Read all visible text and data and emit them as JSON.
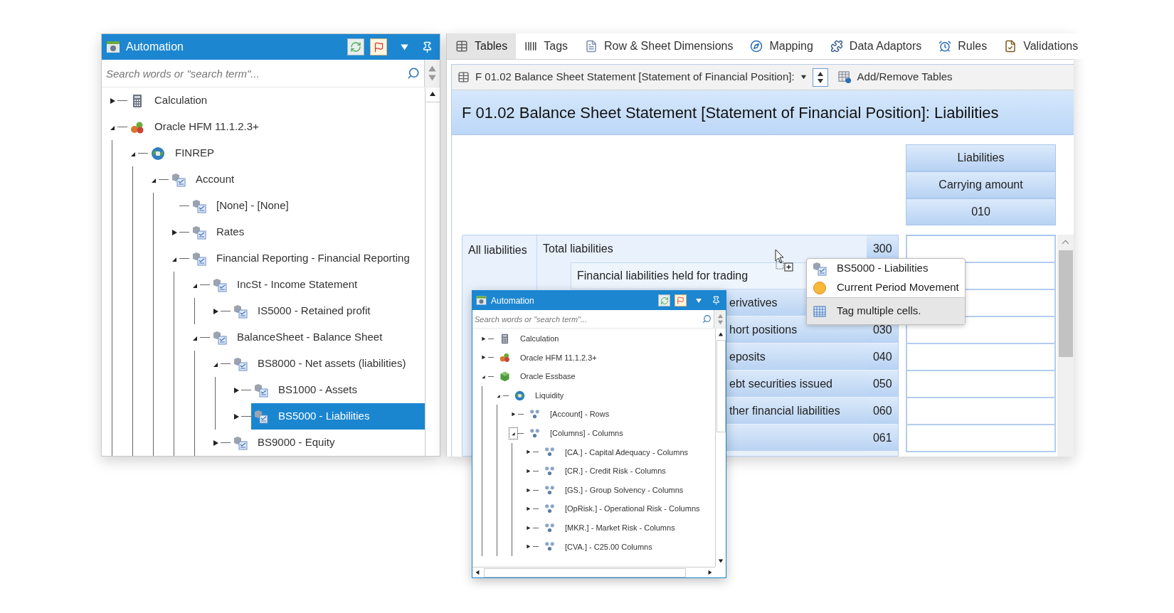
{
  "automation_panel": {
    "title": "Automation",
    "search": {
      "placeholder": "Search words or \"search term\"..."
    },
    "tree": [
      {
        "label": "Calculation",
        "kind": "calculator",
        "expanded": false,
        "selected": false
      },
      {
        "label": "Oracle HFM 11.1.2.3+",
        "kind": "cubes",
        "expanded": true,
        "selected": false,
        "children": [
          {
            "label": "FINREP",
            "kind": "globe",
            "expanded": true,
            "selected": false,
            "children": [
              {
                "label": "Account",
                "kind": "dimension",
                "expanded": true,
                "selected": false,
                "children": [
                  {
                    "label": "[None] - [None]",
                    "kind": "dimension",
                    "selected": false
                  },
                  {
                    "label": "Rates",
                    "kind": "dimension",
                    "expanded": false,
                    "selected": false
                  },
                  {
                    "label": "Financial Reporting - Financial Reporting",
                    "kind": "dimension",
                    "expanded": true,
                    "selected": false,
                    "children": [
                      {
                        "label": "IncSt - Income Statement",
                        "kind": "dimension",
                        "expanded": true,
                        "selected": false,
                        "children": [
                          {
                            "label": "IS5000 - Retained profit",
                            "kind": "dimension",
                            "expanded": false,
                            "selected": false
                          }
                        ]
                      },
                      {
                        "label": "BalanceSheet - Balance Sheet",
                        "kind": "dimension",
                        "expanded": true,
                        "selected": false,
                        "children": [
                          {
                            "label": "BS8000 - Net assets (liabilities)",
                            "kind": "dimension",
                            "expanded": true,
                            "selected": false,
                            "children": [
                              {
                                "label": "BS1000 - Assets",
                                "kind": "dimension",
                                "expanded": false,
                                "selected": false
                              },
                              {
                                "label": "BS5000 - Liabilities",
                                "kind": "dimension",
                                "expanded": false,
                                "selected": true
                              }
                            ]
                          },
                          {
                            "label": "BS9000 - Equity",
                            "kind": "dimension",
                            "expanded": false,
                            "selected": false
                          }
                        ]
                      }
                    ]
                  }
                ]
              }
            ]
          }
        ]
      }
    ]
  },
  "editor": {
    "tabs": [
      {
        "label": "Tables",
        "kind": "tables",
        "selected": true
      },
      {
        "label": "Tags",
        "kind": "tags",
        "selected": false
      },
      {
        "label": "Row & Sheet Dimensions",
        "kind": "dimensions",
        "selected": false
      },
      {
        "label": "Mapping",
        "kind": "mapping",
        "selected": false
      },
      {
        "label": "Data Adaptors",
        "kind": "adaptors",
        "selected": false
      },
      {
        "label": "Rules",
        "kind": "rules",
        "selected": false
      },
      {
        "label": "Validations",
        "kind": "validations",
        "selected": false
      }
    ],
    "table_selector": {
      "value": "F 01.02 Balance Sheet Statement [Statement of Financial Position]:"
    },
    "add_remove_button": "Add/Remove Tables",
    "table_title": "F 01.02 Balance Sheet Statement [Statement of Financial Position]: Liabilities",
    "column_headers": [
      "Liabilities",
      "Carrying amount",
      "010"
    ],
    "row_group": "All liabilities",
    "rows": [
      {
        "kind": "total",
        "label": "Total liabilities",
        "code": "300"
      },
      {
        "kind": "subtotal",
        "label": "Financial liabilities held for trading"
      },
      {
        "kind": "item",
        "label": "erivatives"
      },
      {
        "kind": "item",
        "label": "hort positions",
        "code": "030"
      },
      {
        "kind": "item",
        "label": "eposits",
        "code": "040"
      },
      {
        "kind": "item",
        "label": "ebt securities issued",
        "code": "050"
      },
      {
        "kind": "item",
        "label": "ther financial liabilities",
        "code": "060"
      },
      {
        "kind": "item",
        "code": "061"
      }
    ]
  },
  "floating_panel": {
    "title": "Automation",
    "search": {
      "placeholder": "Search words or \"search term\"..."
    },
    "tree": [
      {
        "label": "Calculation",
        "kind": "calculator",
        "expanded": false,
        "selected": false,
        "focused": false
      },
      {
        "label": "Oracle HFM 11.1.2.3+",
        "kind": "cubes",
        "expanded": false,
        "selected": false,
        "focused": false
      },
      {
        "label": "Oracle Essbase",
        "kind": "essbase",
        "expanded": true,
        "selected": false,
        "focused": false,
        "children": [
          {
            "label": "Liquidity",
            "kind": "globe",
            "expanded": true,
            "selected": false,
            "focused": false,
            "children": [
              {
                "label": "[Account] - Rows",
                "kind": "hierarchy",
                "expanded": false,
                "selected": false,
                "focused": false
              },
              {
                "label": "[Columns] - Columns",
                "kind": "hierarchy",
                "expanded": true,
                "selected": false,
                "focused": true,
                "children": [
                  {
                    "label": "[CA.] - Capital Adequacy - Columns",
                    "kind": "hierarchy",
                    "expanded": false,
                    "selected": false,
                    "focused": false
                  },
                  {
                    "label": "[CR.] - Credit Risk - Columns",
                    "kind": "hierarchy",
                    "expanded": false,
                    "selected": false,
                    "focused": false
                  },
                  {
                    "label": "[GS.] - Group Solvency - Columns",
                    "kind": "hierarchy",
                    "expanded": false,
                    "selected": false,
                    "focused": false
                  },
                  {
                    "label": "[OpRisk.] - Operational Risk - Columns",
                    "kind": "hierarchy",
                    "expanded": false,
                    "selected": false,
                    "focused": false
                  },
                  {
                    "label": "[MKR.] - Market Risk - Columns",
                    "kind": "hierarchy",
                    "expanded": false,
                    "selected": false,
                    "focused": false
                  },
                  {
                    "label": "[CVA.] - C25.00 Columns",
                    "kind": "hierarchy",
                    "expanded": false,
                    "selected": false,
                    "focused": false
                  }
                ]
              }
            ]
          }
        ]
      }
    ]
  },
  "context_menu": {
    "items": [
      {
        "kind": "dimension",
        "label": "BS5000 - Liabilities"
      },
      {
        "kind": "movement",
        "label": "Current Period Movement"
      },
      {
        "kind": "action",
        "label": "Tag multiple cells."
      }
    ]
  }
}
